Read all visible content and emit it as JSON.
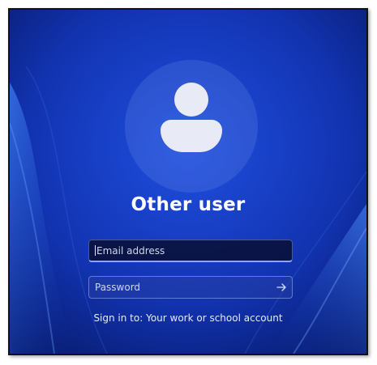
{
  "user": {
    "title": "Other user",
    "avatar_icon": "user-avatar-icon"
  },
  "email": {
    "placeholder": "Email address",
    "value": ""
  },
  "password": {
    "placeholder": "Password",
    "value": "",
    "submit_icon": "arrow-right-icon"
  },
  "signin_text": "Sign in to: Your work or school account",
  "colors": {
    "background": "#0b2a9e",
    "text": "#ffffff",
    "field_focus_border": "#8fa6ff"
  }
}
